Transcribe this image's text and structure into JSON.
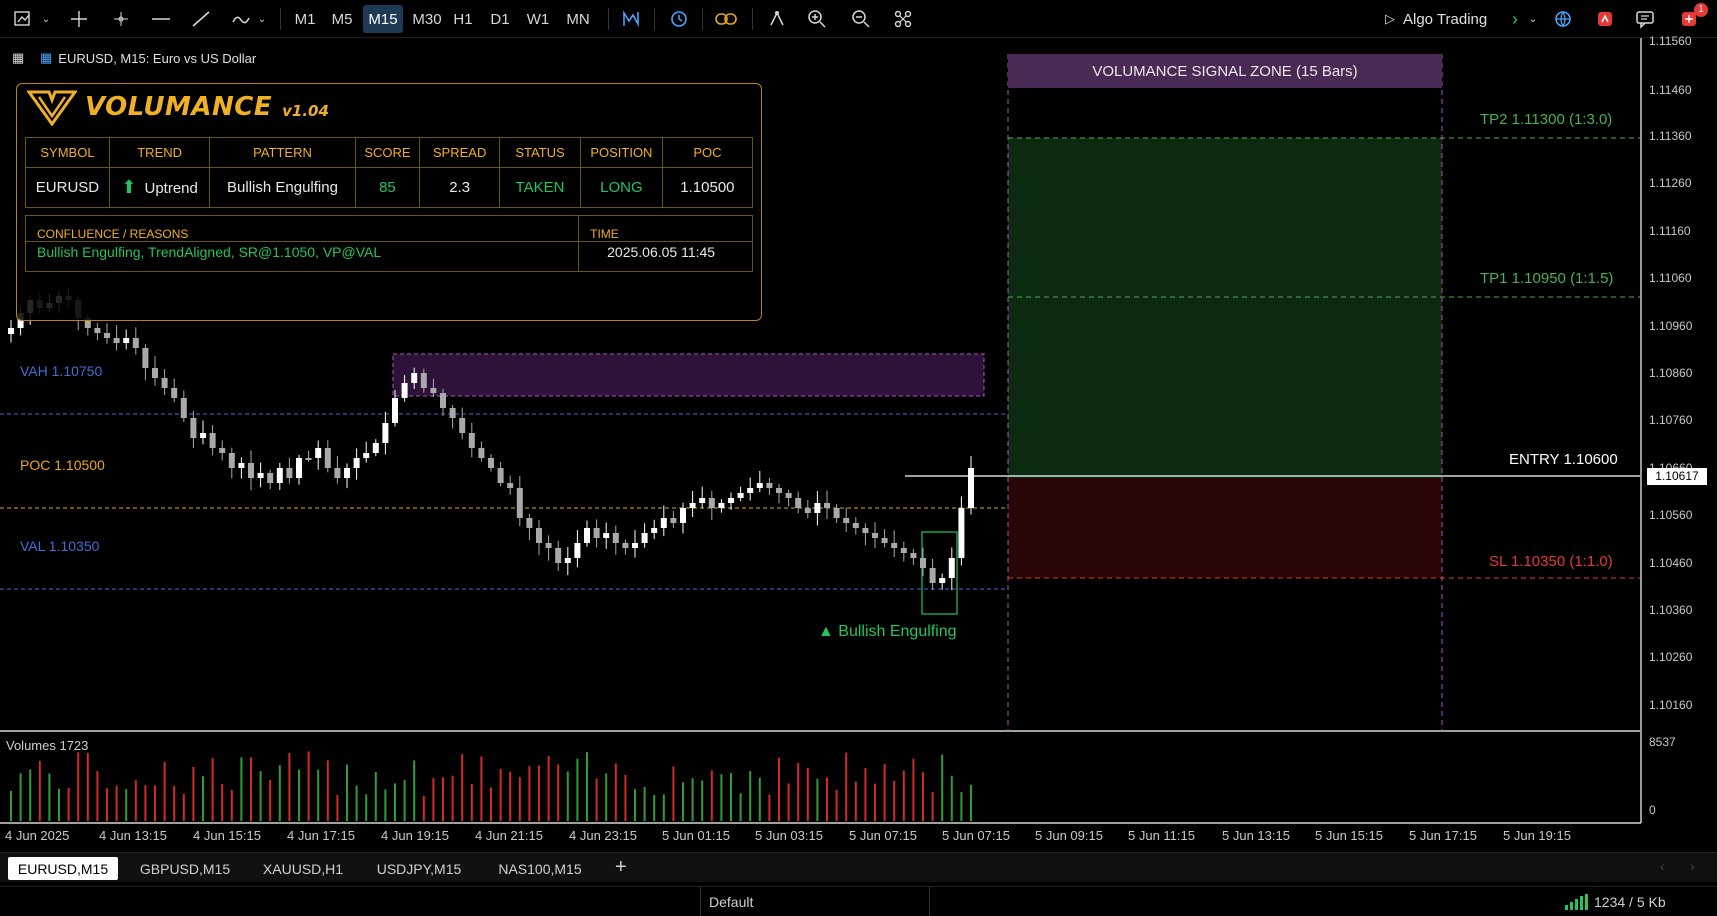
{
  "toolbar": {
    "timeframes": [
      "M1",
      "M5",
      "M15",
      "M30",
      "H1",
      "D1",
      "W1",
      "MN"
    ],
    "active_timeframe": "M15",
    "algo_trading_label": "Algo Trading",
    "notification_count": "1"
  },
  "chart": {
    "title": "EURUSD, M15:  Euro vs US Dollar",
    "current_price": "1.10617",
    "price_axis": [
      "1.11560",
      "1.11460",
      "1.11360",
      "1.11260",
      "1.11160",
      "1.11060",
      "1.10960",
      "1.10860",
      "1.10760",
      "1.10660",
      "1.10560",
      "1.10460",
      "1.10360",
      "1.10260",
      "1.10160"
    ],
    "volume_axis": [
      "8537",
      "0"
    ],
    "volumes_label": "Volumes 1723",
    "time_axis": [
      "4 Jun 2025",
      "4 Jun 13:15",
      "4 Jun 15:15",
      "4 Jun 17:15",
      "4 Jun 19:15",
      "4 Jun 21:15",
      "4 Jun 23:15",
      "5 Jun 01:15",
      "5 Jun 03:15",
      "5 Jun 07:15",
      "5 Jun 07:15",
      "5 Jun 09:15",
      "5 Jun 11:15",
      "5 Jun 13:15",
      "5 Jun 15:15",
      "5 Jun 17:15",
      "5 Jun 19:15"
    ],
    "levels": {
      "vah": "VAH 1.10750",
      "poc": "POC 1.10500",
      "val": "VAL 1.10350"
    },
    "pattern_label": "▲ Bullish Engulfing",
    "zone_title": "VOLUMANCE SIGNAL ZONE (15 Bars)",
    "targets": {
      "tp2": "TP2  1.11300  (1:3.0)",
      "tp1": "TP1  1.10950  (1:1.5)",
      "entry": "ENTRY  1.10600",
      "sl": "SL  1.10350  (1:1.0)"
    },
    "colors": {
      "bull": "#ffffff",
      "bear": "#a9a9a9",
      "vah_val": "#3f6fd8",
      "poc": "#e6a817",
      "tp": "#4caf50",
      "sl": "#e53935",
      "zone": "#b04fc9"
    }
  },
  "panel": {
    "brand": "VOLUMANCE",
    "version": "v1.04",
    "headers": [
      "SYMBOL",
      "TREND",
      "PATTERN",
      "SCORE",
      "SPREAD",
      "STATUS",
      "POSITION",
      "POC"
    ],
    "values": {
      "symbol": "EURUSD",
      "trend": "Uptrend",
      "pattern": "Bullish Engulfing",
      "score": "85",
      "spread": "2.3",
      "status": "TAKEN",
      "position": "LONG",
      "poc": "1.10500"
    },
    "confluence_label": "CONFLUENCE / REASONS",
    "confluence_value": "Bullish Engulfing, TrendAligned, SR@1.1050, VP@VAL",
    "time_label": "TIME",
    "time_value": "2025.06.05 11:45"
  },
  "tabs": [
    "EURUSD,M15",
    "GBPUSD,M15",
    "XAUUSD,H1",
    "USDJPY,M15",
    "NAS100,M15"
  ],
  "active_tab": "EURUSD,M15",
  "status": {
    "profile": "Default",
    "traffic": "1234 / 5 Kb"
  }
}
